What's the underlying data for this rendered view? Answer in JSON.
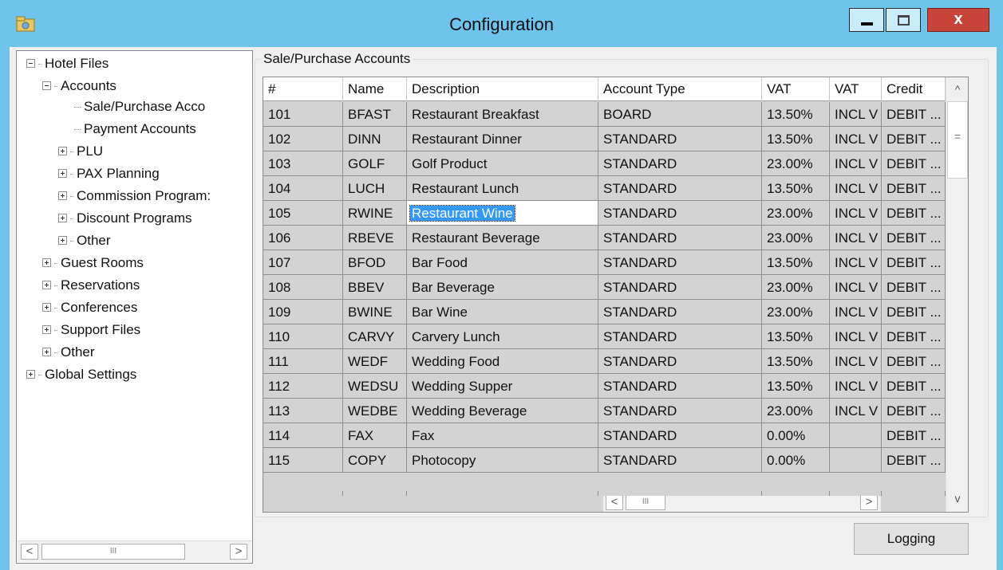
{
  "window": {
    "title": "Configuration",
    "close_label": "x"
  },
  "tree": {
    "nodes": [
      {
        "label": "Hotel Files",
        "expander": "minus"
      },
      {
        "label": "Accounts",
        "expander": "minus"
      },
      {
        "label": "Sale/Purchase Acco",
        "expander": "none"
      },
      {
        "label": "Payment Accounts",
        "expander": "none"
      },
      {
        "label": "PLU",
        "expander": "plus"
      },
      {
        "label": "PAX Planning",
        "expander": "plus"
      },
      {
        "label": "Commission Program:",
        "expander": "plus"
      },
      {
        "label": "Discount Programs",
        "expander": "plus"
      },
      {
        "label": "Other",
        "expander": "plus"
      },
      {
        "label": "Guest Rooms",
        "expander": "plus"
      },
      {
        "label": "Reservations",
        "expander": "plus"
      },
      {
        "label": "Conferences",
        "expander": "plus"
      },
      {
        "label": "Support Files",
        "expander": "plus"
      },
      {
        "label": "Other",
        "expander": "plus"
      },
      {
        "label": "Global Settings",
        "expander": "plus"
      }
    ],
    "scroll_left": "<",
    "scroll_right": ">",
    "scroll_thumb": "III"
  },
  "group": {
    "title": "Sale/Purchase Accounts"
  },
  "grid": {
    "columns": [
      "#",
      "Name",
      "Description",
      "Account Type",
      "VAT",
      "VAT",
      "Credit"
    ],
    "rows": [
      [
        "101",
        "BFAST",
        "Restaurant Breakfast",
        "BOARD",
        "13.50%",
        "INCL V",
        "DEBIT ..."
      ],
      [
        "102",
        "DINN",
        "Restaurant Dinner",
        "STANDARD",
        "13.50%",
        "INCL V",
        "DEBIT ..."
      ],
      [
        "103",
        "GOLF",
        "Golf Product",
        "STANDARD",
        "23.00%",
        "INCL V",
        "DEBIT ..."
      ],
      [
        "104",
        "LUCH",
        "Restaurant Lunch",
        "STANDARD",
        "13.50%",
        "INCL V",
        "DEBIT ..."
      ],
      [
        "105",
        "RWINE",
        "Restaurant Wine",
        "STANDARD",
        "23.00%",
        "INCL V",
        "DEBIT ..."
      ],
      [
        "106",
        "RBEVE",
        "Restaurant Beverage",
        "STANDARD",
        "23.00%",
        "INCL V",
        "DEBIT ..."
      ],
      [
        "107",
        "BFOD",
        "Bar Food",
        "STANDARD",
        "13.50%",
        "INCL V",
        "DEBIT ..."
      ],
      [
        "108",
        "BBEV",
        "Bar Beverage",
        "STANDARD",
        "23.00%",
        "INCL V",
        "DEBIT ..."
      ],
      [
        "109",
        "BWINE",
        "Bar Wine",
        "STANDARD",
        "23.00%",
        "INCL V",
        "DEBIT ..."
      ],
      [
        "110",
        "CARVY",
        "Carvery Lunch",
        "STANDARD",
        "13.50%",
        "INCL V",
        "DEBIT ..."
      ],
      [
        "111",
        "WEDF",
        "Wedding Food",
        "STANDARD",
        "13.50%",
        "INCL V",
        "DEBIT ..."
      ],
      [
        "112",
        "WEDSU",
        "Wedding Supper",
        "STANDARD",
        "13.50%",
        "INCL V",
        "DEBIT ..."
      ],
      [
        "113",
        "WEDBE",
        "Wedding Beverage",
        "STANDARD",
        "23.00%",
        "INCL V",
        "DEBIT ..."
      ],
      [
        "114",
        "FAX",
        "Fax",
        "STANDARD",
        "0.00%",
        "",
        "DEBIT ..."
      ],
      [
        "115",
        "COPY",
        "Photocopy",
        "STANDARD",
        "0.00%",
        "",
        "DEBIT ..."
      ]
    ],
    "selected_row": 4,
    "selected_col": 2,
    "vscroll_up": "^",
    "vscroll_down": "v",
    "vscroll_thumb": "=",
    "hscroll_left": "<",
    "hscroll_right": ">",
    "hscroll_thumb": "III"
  },
  "buttons": {
    "logging": "Logging"
  },
  "colors": {
    "titlebar": "#6ec4ea",
    "close": "#c8443a",
    "selection": "#3399ff",
    "grid_bg": "#d3d3d3"
  }
}
